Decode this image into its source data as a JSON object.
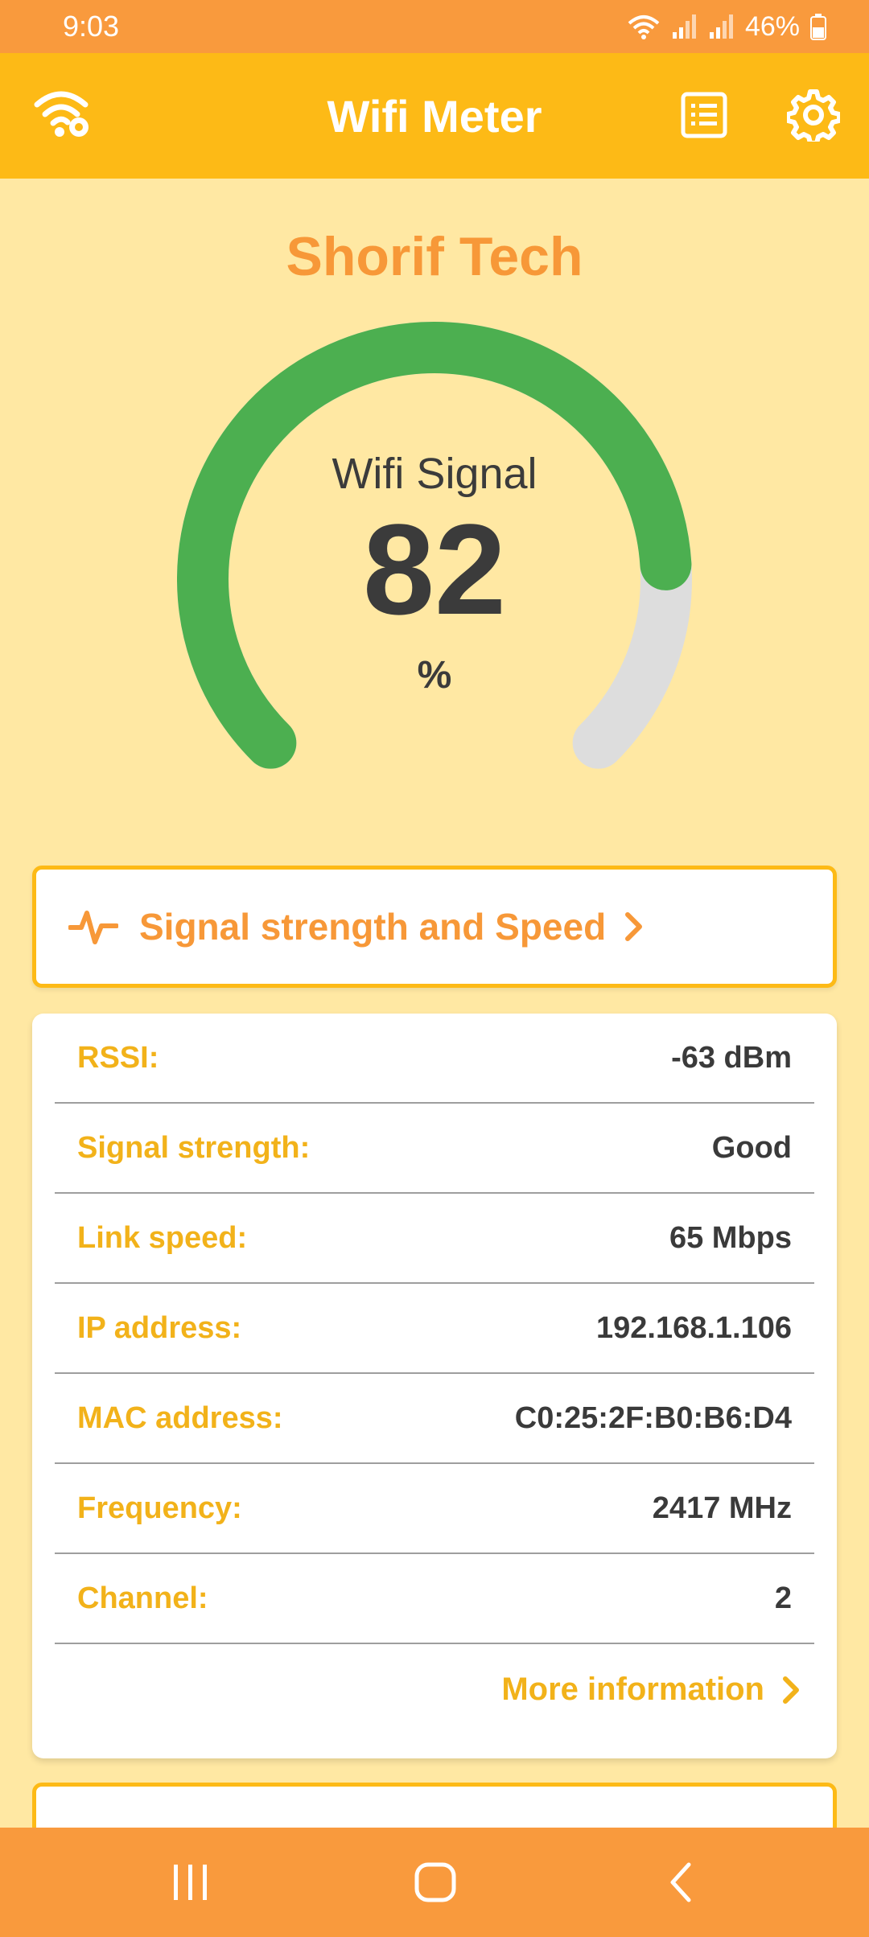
{
  "status_bar": {
    "time": "9:03",
    "battery": "46%"
  },
  "app_bar": {
    "title": "Wifi Meter"
  },
  "brand": "Shorif Tech",
  "gauge": {
    "label": "Wifi Signal",
    "value": "82",
    "unit": "%",
    "fraction": 0.82,
    "color": "#4CAF50",
    "track_color": "#DDDDDD"
  },
  "speed_card": {
    "label": "Signal strength and Speed"
  },
  "info": {
    "rows": [
      {
        "key": "RSSI:",
        "value": "-63 dBm"
      },
      {
        "key": "Signal strength:",
        "value": "Good"
      },
      {
        "key": "Link speed:",
        "value": "65 Mbps"
      },
      {
        "key": "IP address:",
        "value": "192.168.1.106"
      },
      {
        "key": "MAC address:",
        "value": "C0:25:2F:B0:B6:D4"
      },
      {
        "key": "Frequency:",
        "value": "2417 MHz"
      },
      {
        "key": "Channel:",
        "value": "2"
      }
    ],
    "more_label": "More information"
  },
  "colors": {
    "status_bar": "#F99A3D",
    "app_bar": "#FDBA16",
    "background": "#FFE8A3",
    "accent": "#F79838",
    "label": "#F2B21A"
  },
  "icons": [
    "wifi-settings-icon",
    "list-icon",
    "gear-icon",
    "pulse-icon",
    "chevron-right-icon",
    "recents-icon",
    "home-icon",
    "back-icon"
  ]
}
